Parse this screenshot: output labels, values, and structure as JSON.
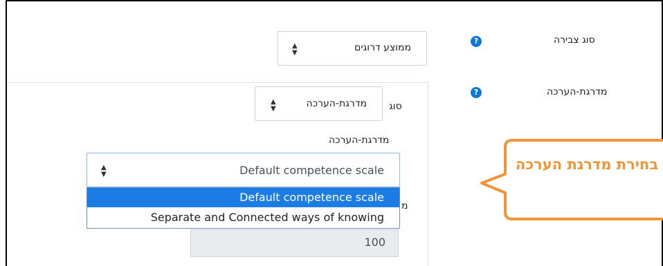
{
  "fields": {
    "aggregation_label": "סוג צבירה",
    "aggregation_value": "ממוצע דרוגים",
    "grade_label": "מדרגת-הערכה",
    "help_glyph": "?"
  },
  "grade_section": {
    "type_label": "סוג",
    "type_value": "מדרגת-הערכה",
    "scale_label": "מדרגת-הערכה",
    "scale_value": "Default competence scale",
    "options": [
      "Default competence scale",
      "Separate and Connected ways of knowing"
    ],
    "max_grade_value": "100",
    "hidden_char": "מ"
  },
  "callout": {
    "text": "בחירת מדרגת הערכה",
    "color": "#f09435"
  },
  "colors": {
    "accent": "#1177d1",
    "selected": "#1c7ce6"
  }
}
